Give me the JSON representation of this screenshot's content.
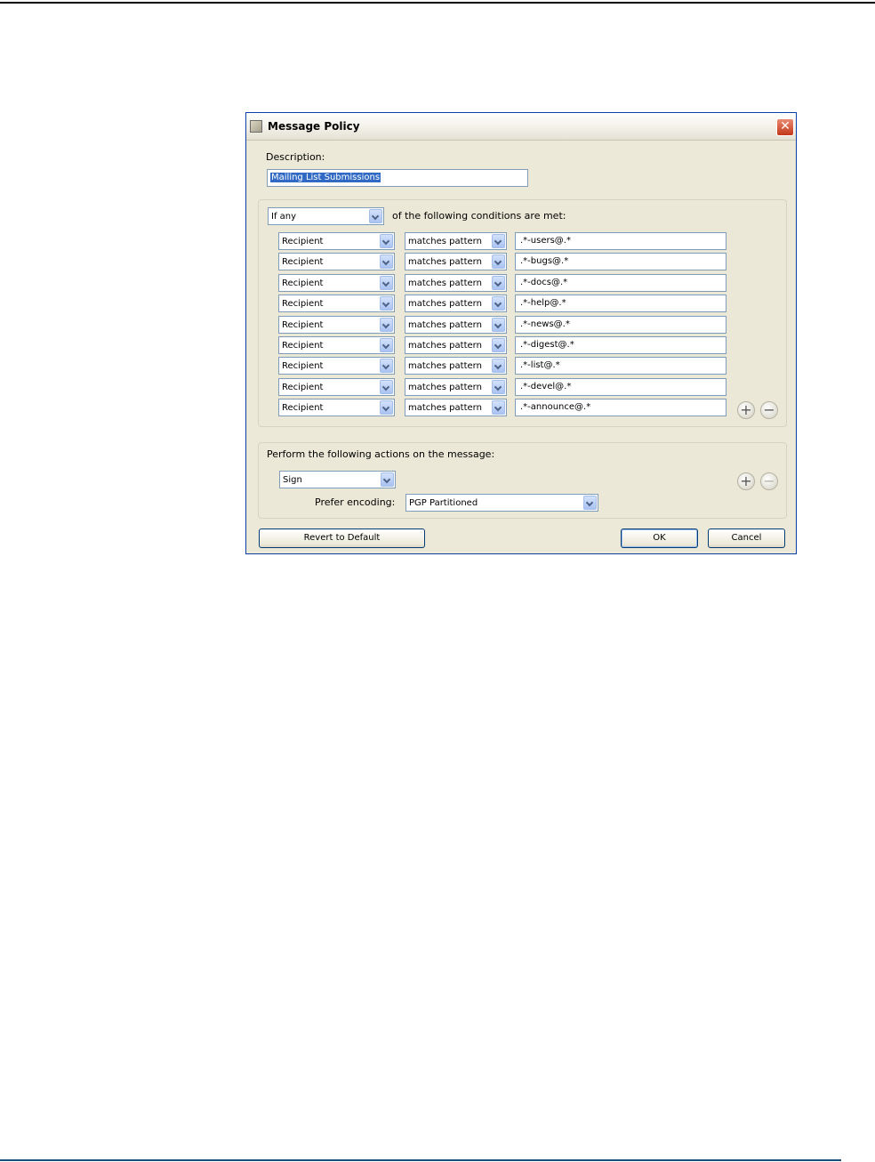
{
  "dialog": {
    "title": "Message Policy",
    "close_glyph": "✕",
    "description_label": "Description:",
    "description_value": "Mailing List Submissions",
    "condition_mode": "If any",
    "condition_suffix": "of the following conditions are met:",
    "conditions": [
      {
        "field": "Recipient",
        "operator": "matches pattern",
        "value": ".*-users@.*"
      },
      {
        "field": "Recipient",
        "operator": "matches pattern",
        "value": ".*-bugs@.*"
      },
      {
        "field": "Recipient",
        "operator": "matches pattern",
        "value": ".*-docs@.*"
      },
      {
        "field": "Recipient",
        "operator": "matches pattern",
        "value": ".*-help@.*"
      },
      {
        "field": "Recipient",
        "operator": "matches pattern",
        "value": ".*-news@.*"
      },
      {
        "field": "Recipient",
        "operator": "matches pattern",
        "value": ".*-digest@.*"
      },
      {
        "field": "Recipient",
        "operator": "matches pattern",
        "value": ".*-list@.*"
      },
      {
        "field": "Recipient",
        "operator": "matches pattern",
        "value": ".*-devel@.*"
      },
      {
        "field": "Recipient",
        "operator": "matches pattern",
        "value": ".*-announce@.*"
      }
    ],
    "actions_heading": "Perform the following actions on the message:",
    "action": "Sign",
    "prefer_encoding_label": "Prefer encoding:",
    "prefer_encoding_value": "PGP Partitioned",
    "add_glyph": "+",
    "remove_glyph": "−",
    "buttons": {
      "revert": "Revert to Default",
      "ok": "OK",
      "cancel": "Cancel"
    }
  },
  "colors": {
    "title_bar_border": "#0b3fa8",
    "dialog_bg": "#ece9d8",
    "selection": "#316ac5",
    "close_button": "#c4381a"
  },
  "icons": [
    "policy-icon",
    "close-icon",
    "dropdown-arrow-icon",
    "plus-icon",
    "minus-icon"
  ]
}
